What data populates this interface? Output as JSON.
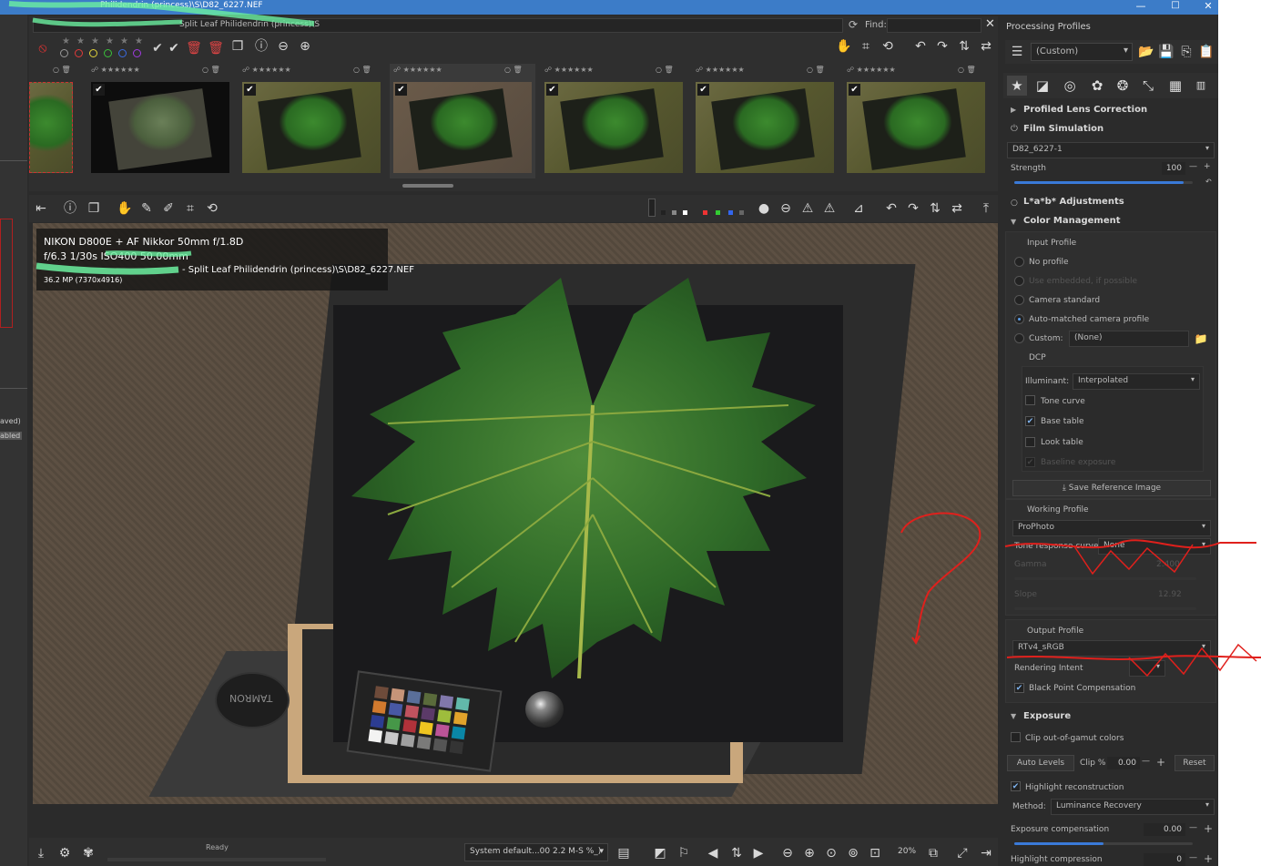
{
  "window": {
    "title_fragment": "Philidendrin (princess)\\S\\D82_6227.NEF"
  },
  "filebrowser": {
    "path_fragment": "Split Leaf Philidendrin (princess)\\S",
    "find_label": "Find:"
  },
  "thumbnails": [
    {
      "checked": false
    },
    {
      "checked": true
    },
    {
      "checked": true
    },
    {
      "checked": true
    },
    {
      "checked": true
    },
    {
      "checked": true
    },
    {
      "checked": true
    }
  ],
  "info_overlay": {
    "line1": "NIKON D800E + AF Nikkor 50mm f/1.8D",
    "line2": "f/6.3  1/30s  ISO400  50.00mm",
    "line3": "- Split Leaf Philidendrin (princess)\\S\\D82_6227.NEF",
    "line4": "36.2 MP (7370x4916)"
  },
  "image": {
    "lens_cap_text": "TAMRON"
  },
  "statusbar": {
    "ready": "Ready",
    "output_profile": "System default...00 2.2 M-S %_)",
    "zoom": "20%"
  },
  "panel": {
    "title": "Processing Profiles",
    "profile_select": "(Custom)",
    "sections": {
      "lens_correction": "Profiled Lens Correction",
      "film_sim": "Film Simulation",
      "lab": "L*a*b* Adjustments",
      "color_mgmt": "Color Management",
      "exposure": "Exposure"
    },
    "film_sim": {
      "select": "D82_6227-1",
      "strength_label": "Strength",
      "strength_value": "100",
      "strength_fraction": 0.95
    },
    "input_profile": {
      "title": "Input Profile",
      "no_profile": "No profile",
      "use_embedded": "Use embedded, if possible",
      "camera_standard": "Camera standard",
      "auto_matched": "Auto-matched camera profile",
      "custom_label": "Custom:",
      "custom_value": "(None)"
    },
    "dcp": {
      "title": "DCP",
      "illuminant_label": "Illuminant:",
      "illuminant_value": "Interpolated",
      "tone_curve": "Tone curve",
      "base_table": "Base table",
      "look_table": "Look table",
      "baseline_exposure": "Baseline exposure",
      "save_ref": "Save Reference Image"
    },
    "working_profile": {
      "title": "Working Profile",
      "value": "ProPhoto",
      "trc_label": "Tone response curve:",
      "trc_value": "None",
      "gamma_label": "Gamma",
      "gamma_value": "2.400",
      "slope_label": "Slope",
      "slope_value": "12.92"
    },
    "output_profile": {
      "title": "Output Profile",
      "value": "RTv4_sRGB",
      "rendering_intent": "Rendering Intent",
      "bpc": "Black Point Compensation"
    },
    "exposure": {
      "clip_gamut": "Clip out-of-gamut colors",
      "auto_levels": "Auto Levels",
      "clip_label": "Clip %",
      "clip_value": "0.00",
      "reset": "Reset",
      "highlight_recon": "Highlight reconstruction",
      "method_label": "Method:",
      "method_value": "Luminance Recovery",
      "exp_comp_label": "Exposure compensation",
      "exp_comp_value": "0.00",
      "highlight_comp_label": "Highlight compression",
      "highlight_comp_value": "0"
    }
  },
  "left_strip": {
    "saved": "aved)",
    "enabled": "abled"
  },
  "colors": {
    "accent": "#3a7ad8",
    "annotation": "#e0201c",
    "highlight_scribble": "#6cf0a0"
  }
}
